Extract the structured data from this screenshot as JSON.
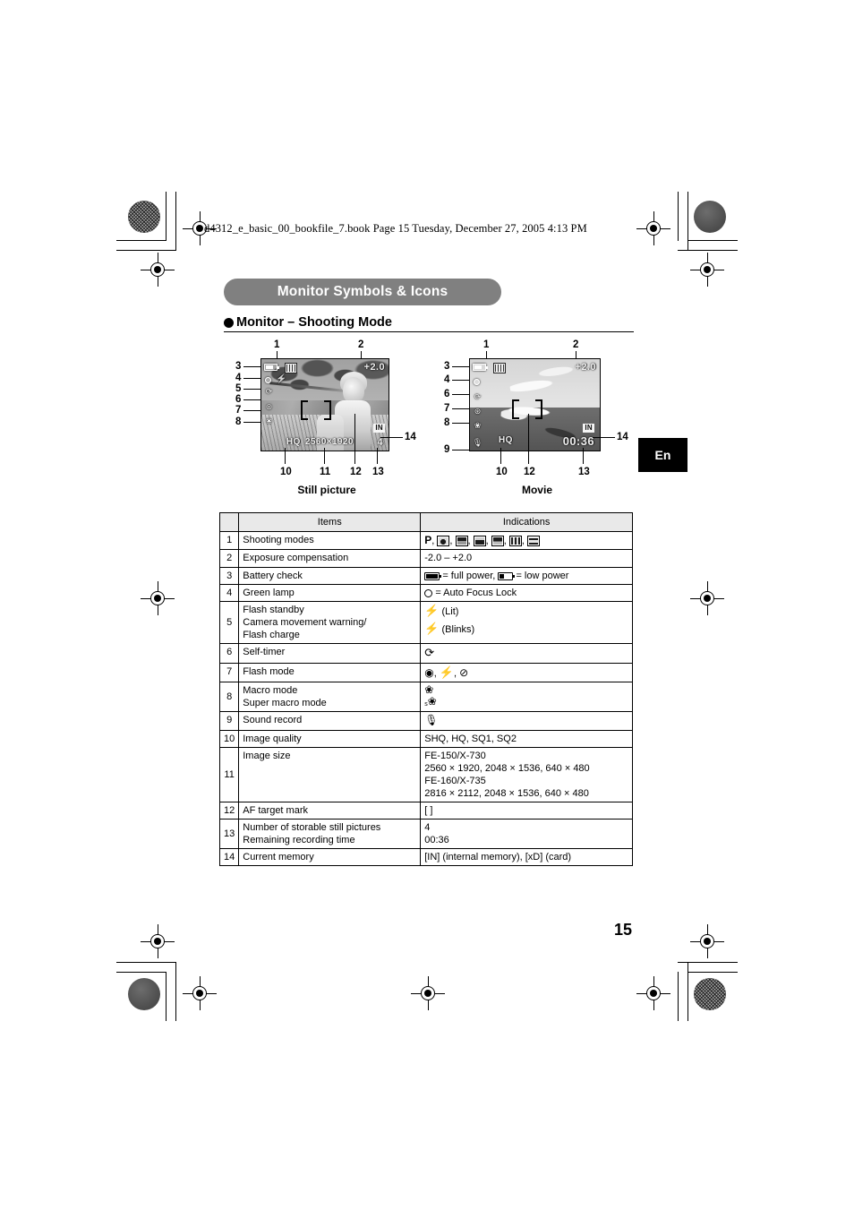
{
  "print_header": "d4312_e_basic_00_bookfile_7.book  Page 15  Tuesday, December 27, 2005  4:13 PM",
  "section": {
    "pill_title": "Monitor Symbols & Icons",
    "subhead": "Monitor – Shooting Mode"
  },
  "figures": {
    "still": {
      "caption": "Still picture",
      "callouts_top": [
        "1",
        "2"
      ],
      "callouts_left": [
        "3",
        "4",
        "5",
        "6",
        "7",
        "8"
      ],
      "callouts_bottom": [
        "10",
        "11",
        "12",
        "13"
      ],
      "callout_right": "14",
      "osd": {
        "exposure": "+2.0",
        "quality": "HQ",
        "image_size": "2560×1920",
        "memory": "IN",
        "mode_icon": "program-mode-icon"
      }
    },
    "movie": {
      "caption": "Movie",
      "callouts_top": [
        "1",
        "2"
      ],
      "callouts_left": [
        "3",
        "4",
        "6",
        "7",
        "8",
        "9"
      ],
      "callouts_bottom": [
        "10",
        "12",
        "13"
      ],
      "callout_right": "14",
      "osd": {
        "exposure": "+2.0",
        "quality": "HQ",
        "time": "00:36",
        "memory": "IN",
        "mode_icon": "movie-mode-icon"
      }
    }
  },
  "table": {
    "headers": {
      "num": "",
      "items": "Items",
      "indications": "Indications"
    },
    "rows": [
      {
        "num": "1",
        "item": "Shooting modes",
        "indication_kind": "mode-icons",
        "indication": "P, [portrait], [landscape+portrait], [landscape], [night scene], [self portrait], [movie]"
      },
      {
        "num": "2",
        "item": "Exposure compensation",
        "indication": "-2.0 – +2.0"
      },
      {
        "num": "3",
        "item": "Battery check",
        "indication_kind": "battery",
        "indication": "[full] = full power, [low] = low power",
        "full_label": "= full power,",
        "low_label": "= low power"
      },
      {
        "num": "4",
        "item": "Green lamp",
        "indication_kind": "circle",
        "indication": "= Auto Focus Lock"
      },
      {
        "num": "5",
        "item": "Flash standby\nCamera movement warning/\nFlash charge",
        "indication_kind": "flash-states",
        "indication": "(Lit)\n(Blinks)",
        "lit": "(Lit)",
        "blinks": "(Blinks)"
      },
      {
        "num": "6",
        "item": "Self-timer",
        "indication_kind": "selftimer",
        "indication": "⟳"
      },
      {
        "num": "7",
        "item": "Flash mode",
        "indication_kind": "flash-modes",
        "indication": "[red-eye], [fill-in], [off]"
      },
      {
        "num": "8",
        "item": "Macro mode\nSuper macro mode",
        "indication_kind": "macro",
        "indication": "[macro]\n[s-macro]"
      },
      {
        "num": "9",
        "item": "Sound record",
        "indication_kind": "mic",
        "indication": "[microphone]"
      },
      {
        "num": "10",
        "item": "Image quality",
        "indication": "SHQ, HQ, SQ1, SQ2"
      },
      {
        "num": "11",
        "item": "Image size",
        "indication": "FE-150/X-730\n   2560 × 1920, 2048 × 1536, 640 × 480\nFE-160/X-735\n   2816 × 2112, 2048 × 1536, 640 × 480"
      },
      {
        "num": "12",
        "item": "AF target mark",
        "indication": "[  ]"
      },
      {
        "num": "13",
        "item": "Number of storable still pictures\nRemaining recording time",
        "indication": "4\n00:36"
      },
      {
        "num": "14",
        "item": "Current memory",
        "indication": "[IN] (internal memory), [xD] (card)"
      }
    ]
  },
  "language_tab": "En",
  "page_number": "15"
}
